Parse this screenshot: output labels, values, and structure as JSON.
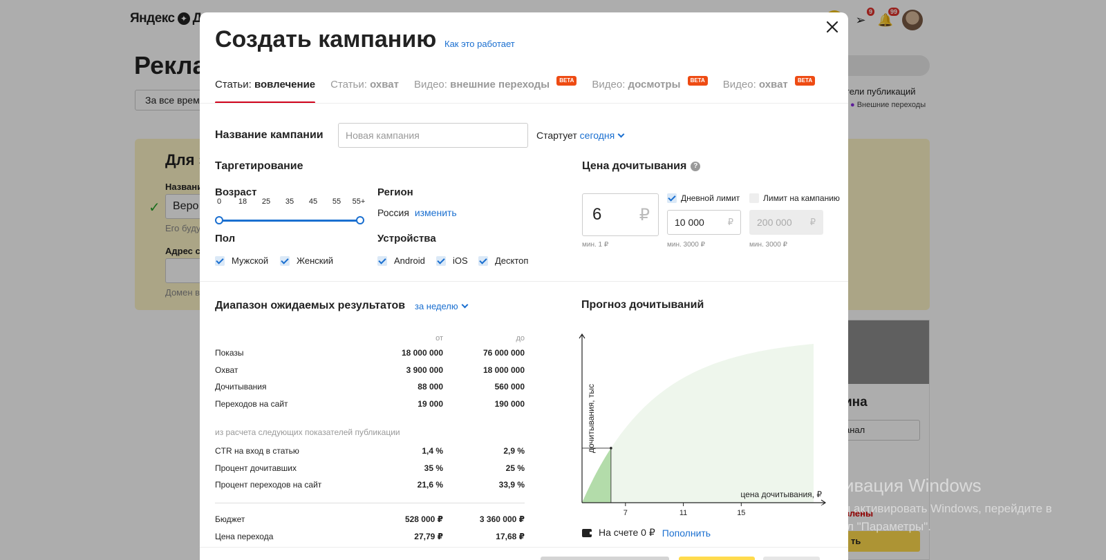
{
  "background": {
    "logo": "Яндекс",
    "logo_tail": "Д",
    "page_title": "Рекла",
    "period_button": "За все время",
    "promo_title": "Для з",
    "name_label": "Названи",
    "name_value": "Веро",
    "name_hint": "Его буду",
    "address_label": "Адрес са",
    "domain_hint": "Домен в",
    "right_metrics": "затели публикаций",
    "right_legend": "Внешние переходы",
    "card_title": "ина",
    "card_button": "канал",
    "card_red": "влены",
    "card_yellow_button": "ть",
    "badge_messages": "9",
    "badge_notifications": "99"
  },
  "windows_activation": {
    "title": "Активация Windows",
    "line1": "Чтобы активировать Windows, перейдите в",
    "line2": "раздел \"Параметры\"."
  },
  "modal": {
    "title": "Создать кампанию",
    "how_it_works": "Как это работает",
    "tabs": [
      {
        "prefix": "Статьи:",
        "label": "вовлечение",
        "beta": ""
      },
      {
        "prefix": "Статьи:",
        "label": "охват",
        "beta": ""
      },
      {
        "prefix": "Видео:",
        "label": "внешние переходы",
        "beta": "BETA"
      },
      {
        "prefix": "Видео:",
        "label": "досмотры",
        "beta": "BETA"
      },
      {
        "prefix": "Видео:",
        "label": "охват",
        "beta": "BETA"
      }
    ],
    "campaign_name_label": "Название кампании",
    "campaign_name_placeholder": "Новая кампания",
    "starts_label": "Стартует",
    "starts_value": "сегодня",
    "targeting_title": "Таргетирование",
    "age_label": "Возраст",
    "age_ticks": [
      "0",
      "18",
      "25",
      "35",
      "45",
      "55",
      "55+"
    ],
    "region_label": "Регион",
    "region_value": "Россия",
    "region_change": "изменить",
    "gender_label": "Пол",
    "gender_options": [
      "Мужской",
      "Женский"
    ],
    "devices_label": "Устройства",
    "device_options": [
      "Android",
      "iOS",
      "Десктоп"
    ],
    "price_title": "Цена дочитывания",
    "price_value": "6",
    "currency": "₽",
    "price_min": "мин. 1 ₽",
    "daily_limit_label": "Дневной лимит",
    "daily_limit_value": "10 000",
    "daily_limit_min": "мин. 3000 ₽",
    "campaign_limit_label": "Лимит на кампанию",
    "campaign_limit_value": "200 000",
    "campaign_limit_min": "мин. 3000 ₽",
    "range_title": "Диапазон ожидаемых результатов",
    "range_period": "за неделю",
    "col_from": "от",
    "col_to": "до",
    "results": [
      {
        "label": "Показы",
        "from": "18 000 000",
        "to": "76 000 000"
      },
      {
        "label": "Охват",
        "from": "3 900 000",
        "to": "18 000 000"
      },
      {
        "label": "Дочитывания",
        "from": "88 000",
        "to": "560 000"
      },
      {
        "label": "Переходов на сайт",
        "from": "19 000",
        "to": "190 000"
      }
    ],
    "basis_note": "из расчета следующих показателей публикации",
    "basis": [
      {
        "label": "CTR на вход в статью",
        "from": "1,4 %",
        "to": "2,9 %"
      },
      {
        "label": "Процент дочитавших",
        "from": "35 %",
        "to": "25 %"
      },
      {
        "label": "Процент переходов на сайт",
        "from": "21,6 %",
        "to": "33,9 %"
      }
    ],
    "budget": [
      {
        "label": "Бюджет",
        "from": "528 000 ₽",
        "to": "3 360 000 ₽"
      },
      {
        "label": "Цена перехода",
        "from": "27,79 ₽",
        "to": "17,68 ₽"
      }
    ],
    "forecast_title": "Прогноз дочитываний",
    "balance_label": "На счете 0 ₽",
    "top_up": "Пополнить"
  },
  "chart_data": {
    "type": "area",
    "ylabel": "дочитывания, тыс",
    "xlabel": "цена дочитывания, ₽",
    "x_ticks": [
      7,
      11,
      15
    ],
    "xlim": [
      4,
      20
    ],
    "selected_price": 6,
    "colors": {
      "full_area": "#eef6ec",
      "selected_area": "#b3dcaa",
      "axis": "#222"
    }
  }
}
